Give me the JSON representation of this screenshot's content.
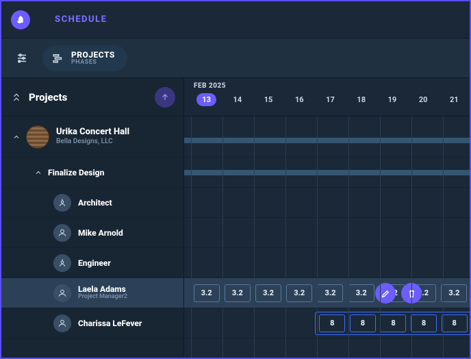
{
  "header": {
    "title": "SCHEDULE"
  },
  "view_toggle": {
    "primary": "PROJECTS",
    "secondary": "PHASES"
  },
  "sidebar": {
    "heading": "Projects"
  },
  "timeline": {
    "month": "FEB 2025",
    "days": [
      "13",
      "14",
      "15",
      "16",
      "17",
      "18",
      "19",
      "20",
      "21"
    ],
    "today_index": 0
  },
  "project": {
    "name": "Urika Concert Hall",
    "client": "Bella Designs, LLC",
    "phase": "Finalize Design",
    "roles": [
      {
        "label": "Architect",
        "type": "role"
      },
      {
        "label": "Mike Arnold",
        "type": "person"
      },
      {
        "label": "Engineer",
        "type": "role"
      },
      {
        "label": "Laela Adams",
        "sublabel": "Project Manager2",
        "type": "person"
      },
      {
        "label": "Charissa LeFever",
        "type": "person"
      }
    ]
  },
  "allocations": {
    "laela": {
      "value": "3.2",
      "columns": [
        0,
        1,
        2,
        3,
        4,
        5,
        6,
        7,
        8
      ]
    },
    "charissa": {
      "value": "8",
      "columns": [
        4,
        5,
        6,
        7,
        8
      ]
    }
  }
}
